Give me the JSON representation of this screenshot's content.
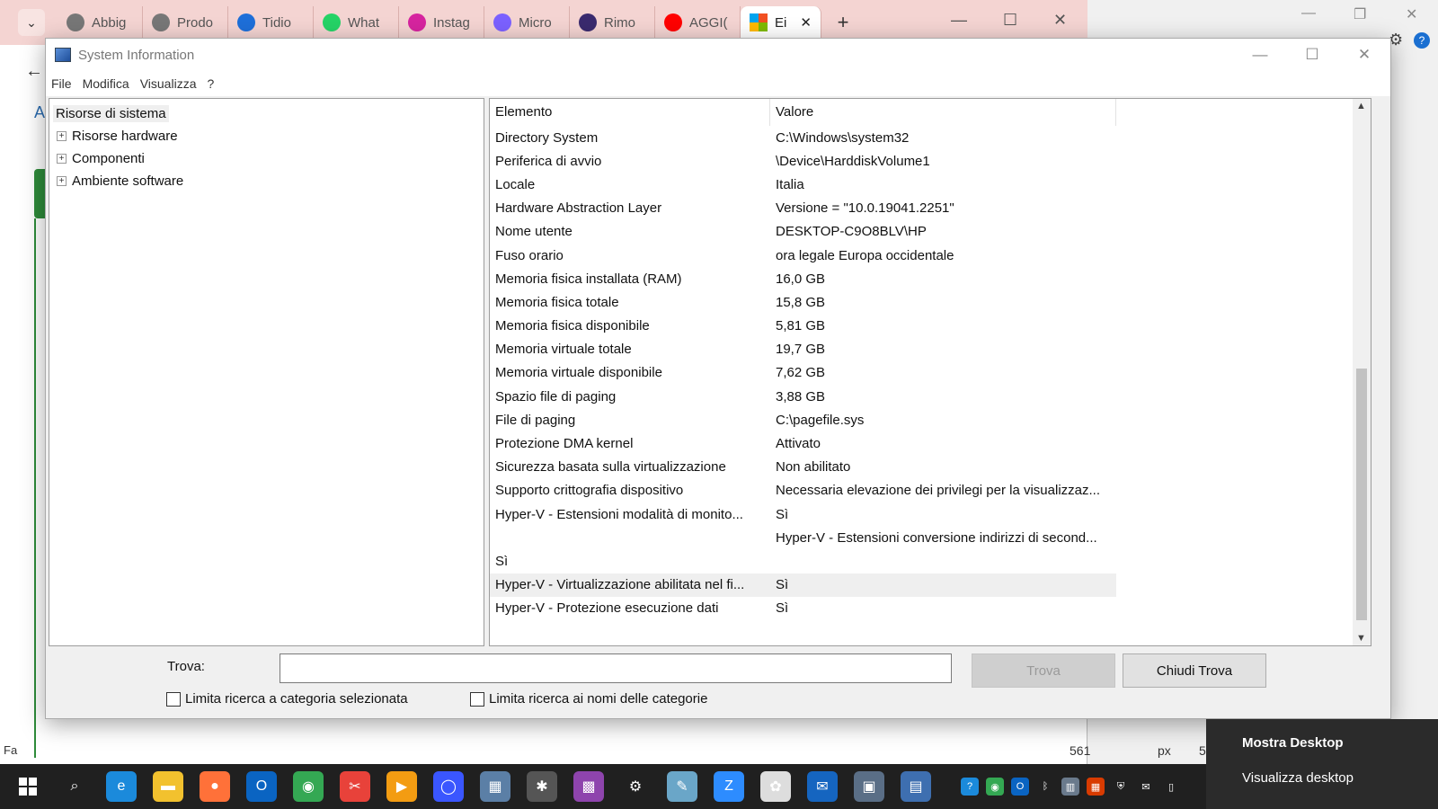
{
  "browser": {
    "tabs": [
      {
        "label": "Abbig",
        "icon": "app-icon",
        "color": "#777777"
      },
      {
        "label": "Prodo",
        "icon": "app-icon",
        "color": "#777777"
      },
      {
        "label": "Tidio",
        "icon": "chat-icon",
        "color": "#1e6fd9"
      },
      {
        "label": "What",
        "icon": "whatsapp-icon",
        "color": "#25d366"
      },
      {
        "label": "Instag",
        "icon": "instagram-icon",
        "color": "#d6249f"
      },
      {
        "label": "Micro",
        "icon": "copilot-icon",
        "color": "#7b61ff"
      },
      {
        "label": "Rimo",
        "icon": "remove-icon",
        "color": "#3a2a6e"
      },
      {
        "label": "AGGI(",
        "icon": "youtube-icon",
        "color": "#ff0000"
      }
    ],
    "active_tab": {
      "label": "Ei",
      "icon": "windows-icon"
    },
    "new_tab": "+",
    "side_letter": "A"
  },
  "window": {
    "title": "System Information",
    "menu": [
      "File",
      "Modifica",
      "Visualizza",
      "?"
    ]
  },
  "tree": {
    "root": "Risorse di sistema",
    "items": [
      "Risorse hardware",
      "Componenti",
      "Ambiente software"
    ]
  },
  "list": {
    "headers": {
      "element": "Elemento",
      "value": "Valore"
    },
    "rows": [
      {
        "element": "Directory System",
        "value": "C:\\Windows\\system32"
      },
      {
        "element": "Periferica di avvio",
        "value": "\\Device\\HarddiskVolume1"
      },
      {
        "element": "Locale",
        "value": "Italia"
      },
      {
        "element": "Hardware Abstraction Layer",
        "value": "Versione = \"10.0.19041.2251\""
      },
      {
        "element": "Nome utente",
        "value": "DESKTOP-C9O8BLV\\HP"
      },
      {
        "element": "Fuso orario",
        "value": "ora legale Europa occidentale"
      },
      {
        "element": "Memoria fisica installata (RAM)",
        "value": "16,0 GB"
      },
      {
        "element": "Memoria fisica totale",
        "value": "15,8 GB"
      },
      {
        "element": "Memoria fisica disponibile",
        "value": "5,81 GB"
      },
      {
        "element": "Memoria virtuale totale",
        "value": "19,7 GB"
      },
      {
        "element": "Memoria virtuale disponibile",
        "value": "7,62 GB"
      },
      {
        "element": "Spazio file di paging",
        "value": "3,88 GB"
      },
      {
        "element": "File di paging",
        "value": "C:\\pagefile.sys"
      },
      {
        "element": "Protezione DMA kernel",
        "value": "Attivato"
      },
      {
        "element": "Sicurezza basata sulla virtualizzazione",
        "value": "Non abilitato"
      },
      {
        "element": "Supporto crittografia dispositivo",
        "value": "Necessaria elevazione dei privilegi per la visualizzaz..."
      },
      {
        "element": "Hyper-V - Estensioni modalità di monito...",
        "value": "Sì"
      },
      {
        "element": "",
        "value": "Hyper-V - Estensioni conversione indirizzi di second..."
      },
      {
        "element": "Sì",
        "value": ""
      },
      {
        "element": "Hyper-V - Virtualizzazione abilitata nel fi...",
        "value": "Sì"
      },
      {
        "element": "Hyper-V - Protezione esecuzione dati",
        "value": "Sì"
      }
    ],
    "selected_row": 19
  },
  "find": {
    "label": "Trova:",
    "input_value": "",
    "find_button": "Trova",
    "close_button": "Chiudi Trova",
    "check1": "Limita ricerca a categoria selezionata",
    "check2": "Limita ricerca ai nomi delle categorie"
  },
  "status": {
    "left": "Fa",
    "coord": "561",
    "unit": "px",
    "right": "5"
  },
  "desktop_popup": {
    "title": "Mostra Desktop",
    "subtitle": "Visualizza desktop"
  },
  "taskbar": {
    "icons": [
      {
        "name": "search-icon",
        "color": "#202020",
        "glyph": "⌕"
      },
      {
        "name": "edge-icon",
        "color": "#1b8adb",
        "glyph": "e"
      },
      {
        "name": "file-explorer-icon",
        "color": "#f2c12e",
        "glyph": "▬"
      },
      {
        "name": "firefox-icon",
        "color": "#ff7139",
        "glyph": "●"
      },
      {
        "name": "outlook-icon",
        "color": "#0a64c2",
        "glyph": "O"
      },
      {
        "name": "chrome-icon",
        "color": "#34a853",
        "glyph": "◉"
      },
      {
        "name": "snip-icon",
        "color": "#e8423a",
        "glyph": "✂"
      },
      {
        "name": "media-player-icon",
        "color": "#f39c12",
        "glyph": "▶"
      },
      {
        "name": "messenger-icon",
        "color": "#3a56ff",
        "glyph": "◯"
      },
      {
        "name": "calculator-icon",
        "color": "#5b7fa6",
        "glyph": "▦"
      },
      {
        "name": "photo-app-icon",
        "color": "#555555",
        "glyph": "✱"
      },
      {
        "name": "color-app-icon",
        "color": "#8e44ad",
        "glyph": "▩"
      },
      {
        "name": "settings-icon",
        "color": "#202020",
        "glyph": "⚙"
      },
      {
        "name": "notepad-icon",
        "color": "#6aa6c8",
        "glyph": "✎"
      },
      {
        "name": "zoom-icon",
        "color": "#2d8cff",
        "glyph": "Z"
      },
      {
        "name": "snipping-icon",
        "color": "#dddddd",
        "glyph": "✿"
      },
      {
        "name": "outlook-new-icon",
        "color": "#1565c0",
        "glyph": "✉"
      },
      {
        "name": "remote-icon",
        "color": "#5a6e86",
        "glyph": "▣"
      },
      {
        "name": "sysinfo-icon",
        "color": "#3e6fb0",
        "glyph": "▤"
      }
    ],
    "tray": [
      {
        "name": "help-icon",
        "color": "#1b8adb",
        "glyph": "?"
      },
      {
        "name": "chrome-tray-icon",
        "color": "#34a853",
        "glyph": "◉"
      },
      {
        "name": "outlook-tray-icon",
        "color": "#0a64c2",
        "glyph": "O"
      },
      {
        "name": "bluetooth-icon",
        "color": "#202020",
        "glyph": "ᛒ"
      },
      {
        "name": "network-icon",
        "color": "#6a7a8c",
        "glyph": "▥"
      },
      {
        "name": "office-icon",
        "color": "#d83b01",
        "glyph": "▦"
      },
      {
        "name": "security-icon",
        "color": "#202020",
        "glyph": "⛨"
      },
      {
        "name": "mail-icon",
        "color": "#202020",
        "glyph": "✉"
      },
      {
        "name": "usb-icon",
        "color": "#202020",
        "glyph": "▯"
      }
    ]
  }
}
